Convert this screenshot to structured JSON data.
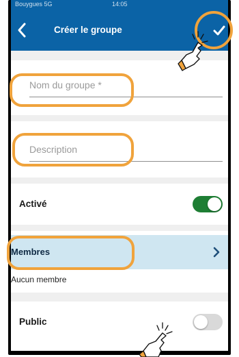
{
  "status_bar": {
    "carrier": "Bouygues 5G",
    "time": "14:05"
  },
  "nav_bar": {
    "title": "Créer le groupe",
    "back_icon": "chevron-left-icon",
    "confirm_icon": "checkmark-icon"
  },
  "form": {
    "name": {
      "placeholder": "Nom du groupe *",
      "value": ""
    },
    "description": {
      "placeholder": "Description",
      "value": ""
    }
  },
  "active": {
    "label": "Activé",
    "on": true
  },
  "members": {
    "label": "Membres",
    "subtitle": "Aucun membre",
    "chevron_icon": "chevron-right-icon"
  },
  "public": {
    "label": "Public",
    "on": false
  },
  "colors": {
    "header_blue": "#0b63a6",
    "toggle_green": "#1e7e34",
    "toggle_off": "#d9d9d9",
    "members_highlight": "#cfe6f1",
    "callout_orange": "#f0a33c",
    "chevron_blue": "#1f4f7a"
  },
  "annotations": {
    "pointer_icon": "pointing-hand-icon"
  }
}
